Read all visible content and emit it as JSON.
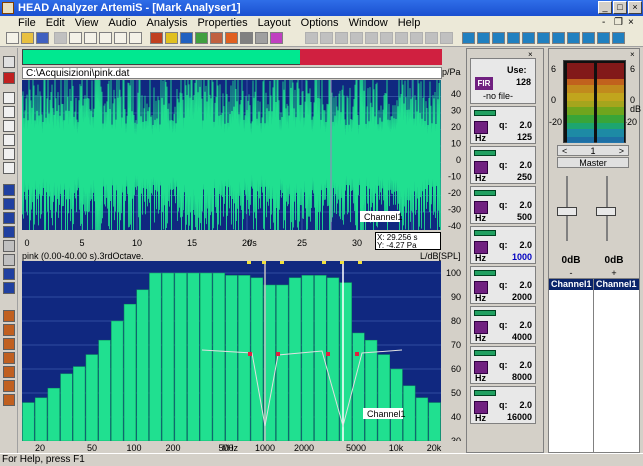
{
  "window": {
    "title": "HEAD Analyzer ArtemiS - [Mark Analyser1]",
    "min": "_",
    "max": "□",
    "close": "×"
  },
  "menu": [
    "File",
    "Edit",
    "View",
    "Audio",
    "Analysis",
    "Properties",
    "Layout",
    "Options",
    "Window",
    "Help"
  ],
  "inner_controls": {
    "min": "-",
    "restore": "❐",
    "close": "×"
  },
  "signal": {
    "path": "C:\\Acquisizioni\\pink.dat",
    "y_unit": "p/Pa",
    "x_unit": "t/s",
    "channel": "Channel1",
    "y_ticks": [
      "40",
      "30",
      "20",
      "10",
      "0",
      "-10",
      "-20",
      "-30",
      "-40"
    ],
    "x_ticks": [
      "0",
      "5",
      "10",
      "15",
      "20",
      "25",
      "30",
      "35"
    ],
    "cursor_x": "X: 29.256 s",
    "cursor_y": "Y: -4.27 Pa"
  },
  "spectrum": {
    "info": "pink (0.00-40.00 s).3rdOctave.",
    "y_unit": "L/dB[SPL]",
    "x_unit": "f/Hz",
    "channel": "Channel1",
    "y_ticks": [
      "100",
      "90",
      "80",
      "70",
      "60",
      "50",
      "40",
      "30"
    ],
    "x_ticks": [
      "20",
      "50",
      "100",
      "200",
      "500",
      "1000",
      "2000",
      "5000",
      "10k",
      "20k"
    ]
  },
  "chart_data": {
    "type": "bar",
    "ylabel": "L/dB[SPL]",
    "xlabel": "f/Hz",
    "ylim": [
      30,
      105
    ],
    "values": [
      46,
      48,
      52,
      58,
      61,
      66,
      72,
      80,
      87,
      93,
      100,
      100,
      100,
      100,
      100,
      100,
      99,
      99,
      98,
      95,
      95,
      98,
      99,
      99,
      98,
      96,
      75,
      72,
      66,
      60,
      53,
      48,
      46
    ]
  },
  "filter_bank": {
    "use_label": "Use:",
    "use_value": "128",
    "fir_label": "FIR",
    "file_label": "-no file-",
    "q_label": "q:",
    "hz_label": "Hz",
    "bands": [
      {
        "q": "2.0",
        "f": "125"
      },
      {
        "q": "2.0",
        "f": "250"
      },
      {
        "q": "2.0",
        "f": "500"
      },
      {
        "q": "2.0",
        "f": "1000"
      },
      {
        "q": "2.0",
        "f": "2000"
      },
      {
        "q": "2.0",
        "f": "4000"
      },
      {
        "q": "2.0",
        "f": "8000"
      },
      {
        "q": "2.0",
        "f": "16000"
      }
    ]
  },
  "mixer": {
    "scale": [
      "6",
      "0",
      "-20"
    ],
    "scale_unit": "dB",
    "master_index": "1",
    "master_label": "Master",
    "gain_left": "0dB",
    "gain_right": "0dB",
    "col_left": "-",
    "col_right": "+",
    "channel_left": "Channel1",
    "channel_right": "Channel1"
  },
  "status": "For Help, press F1",
  "colors": {
    "plot_bg": "#102880",
    "signal": "#20e090",
    "bars": "#20e090",
    "title": "#1a4fd0"
  }
}
